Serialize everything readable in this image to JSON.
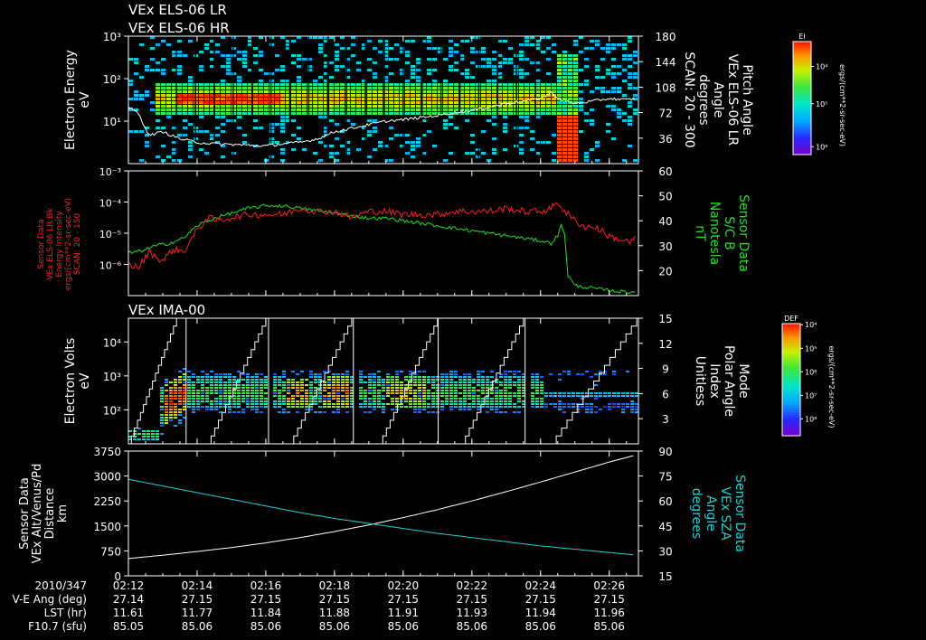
{
  "titles": {
    "top_1": "VEx ELS-06 LR",
    "top_2": "VEx ELS-06 HR",
    "ima": "VEx IMA-00"
  },
  "colors": {
    "background": "#000000",
    "axis": "#ffffff",
    "red_trace": "#ff2020",
    "green_trace": "#20e020",
    "cyan_trace": "#20d0d0",
    "white_trace": "#ffffff"
  },
  "colorbars": [
    {
      "title": "EI",
      "unit_label": "ergs/(cm**2-sr-sec-eV)",
      "tick_labels": [
        "10⁴",
        "10⁵",
        "10⁶"
      ],
      "tick_fractions": [
        0.78,
        0.45,
        0.07
      ]
    },
    {
      "title": "DEF",
      "unit_label": "ergs/(cm**2-sr-sec-eV)",
      "tick_labels": [
        "10⁴",
        "10⁵",
        "10⁶",
        "10⁷",
        "10⁸"
      ],
      "tick_fractions": [
        0.99,
        0.78,
        0.57,
        0.36,
        0.15
      ]
    }
  ],
  "panels": {
    "els": {
      "left_label": [
        "Electron Energy",
        "eV"
      ],
      "right_label": [
        "Pitch Angle",
        "VEx ELS-06 LR",
        "Angle",
        "degrees",
        "SCAN: 20 - 300"
      ],
      "left_ticks": [
        "10³",
        "10²",
        "10¹"
      ],
      "left_tick_values": [
        1000,
        100,
        10
      ],
      "right_ticks": [
        "180",
        "144",
        "108",
        "72",
        "36"
      ],
      "right_tick_values": [
        180,
        144,
        108,
        72,
        36
      ]
    },
    "sensor": {
      "left_label": [
        "Sensor Data",
        "VEx ELS-06 LR Bk",
        "Energy Intensity",
        "ergs/(cm**2-sr-sec-eV)",
        "SCAN: 20 - 150"
      ],
      "right_label": [
        "Sensor Data",
        "S/C B",
        "Nanotesla",
        "nT"
      ],
      "left_ticks": [
        "10⁻³",
        "10⁻⁴",
        "10⁻⁵",
        "10⁻⁶"
      ],
      "left_tick_values": [
        -3,
        -4,
        -5,
        -6
      ],
      "right_ticks": [
        "60",
        "50",
        "40",
        "30",
        "20"
      ],
      "right_tick_values": [
        60,
        50,
        40,
        30,
        20
      ]
    },
    "ima": {
      "left_label": [
        "Electron Volts",
        "eV"
      ],
      "right_label": [
        "Mode",
        "Polar Angle",
        "Index",
        "Unitless"
      ],
      "left_ticks": [
        "10⁴",
        "10³",
        "10²"
      ],
      "left_tick_values": [
        10000,
        1000,
        100
      ],
      "right_ticks": [
        "15",
        "12",
        "9",
        "6",
        "3"
      ],
      "right_tick_values": [
        15,
        12,
        9,
        6,
        3
      ]
    },
    "distance": {
      "left_label": [
        "Sensor Data",
        "VEx Alt/Venus/Pd",
        "Distance",
        "km"
      ],
      "right_label": [
        "Sensor Data",
        "VEx SZA",
        "Angle",
        "degrees"
      ],
      "left_ticks": [
        "3750",
        "3000",
        "2250",
        "1500",
        "750",
        "0"
      ],
      "left_tick_values": [
        3750,
        3000,
        2250,
        1500,
        750,
        0
      ],
      "right_ticks": [
        "90",
        "75",
        "60",
        "45",
        "30",
        "15"
      ],
      "right_tick_values": [
        90,
        75,
        60,
        45,
        30,
        15
      ]
    }
  },
  "time_axis": {
    "date": "2010/347",
    "row_labels": [
      "V-E Ang (deg)",
      "LST (hr)",
      "F10.7 (sfu)"
    ],
    "ticks": [
      "02:12",
      "02:14",
      "02:16",
      "02:18",
      "02:20",
      "02:22",
      "02:24",
      "02:26"
    ],
    "tick_minutes": [
      12,
      14,
      16,
      18,
      20,
      22,
      24,
      26
    ],
    "ve_ang": [
      "27.14",
      "27.15",
      "27.15",
      "27.15",
      "27.15",
      "27.15",
      "27.15",
      "27.15"
    ],
    "lst": [
      "11.61",
      "11.77",
      "11.84",
      "11.88",
      "11.91",
      "11.93",
      "11.94",
      "11.96"
    ],
    "f107": [
      "85.05",
      "85.06",
      "85.06",
      "85.06",
      "85.06",
      "85.06",
      "85.06",
      "85.06"
    ]
  },
  "chart_data": [
    {
      "type": "heatmap",
      "panel": "els",
      "ylabel": "Electron Energy eV",
      "ylim": [
        1,
        1000
      ],
      "y_scale": "log",
      "y2label": "Pitch Angle VEx ELS-06 LR Angle degrees SCAN: 20 - 300",
      "y2lim": [
        0,
        180
      ],
      "overlay_series": {
        "name": "Pitch Angle",
        "x_minutes": [
          12.0,
          12.3,
          12.6,
          13.0,
          13.5,
          14.0,
          14.5,
          15.0,
          15.5,
          16.0,
          16.5,
          17.0,
          17.5,
          18.0,
          18.5,
          19.0,
          19.5,
          20.0,
          20.5,
          21.0,
          21.5,
          22.0,
          22.5,
          23.0,
          23.5,
          24.0,
          24.3,
          24.6,
          25.0,
          25.5,
          26.0,
          26.5,
          26.8
        ],
        "values": [
          80,
          70,
          40,
          45,
          35,
          30,
          28,
          27,
          26,
          25,
          28,
          30,
          35,
          45,
          50,
          55,
          60,
          62,
          65,
          68,
          72,
          75,
          80,
          85,
          88,
          92,
          100,
          90,
          85,
          88,
          92,
          90,
          92
        ]
      }
    },
    {
      "type": "line",
      "panel": "sensor",
      "ylabel": "Sensor Data VEx ELS-06 LR Bk Energy Intensity ergs/(cm**2-sr-sec-eV) SCAN: 20 - 150",
      "y_scale": "log",
      "ylim_log10": [
        -7,
        -3
      ],
      "y2label": "Sensor Data S/C B Nanotesla nT",
      "y2lim": [
        10,
        60
      ],
      "series": [
        {
          "name": "Sensor Data VEx ELS-06 LR Bk",
          "axis": "left",
          "x_minutes": [
            12.0,
            12.3,
            12.6,
            13.0,
            13.3,
            13.6,
            14.0,
            14.3,
            14.6,
            15.0,
            15.5,
            16.0,
            16.5,
            17.0,
            17.5,
            18.0,
            18.5,
            19.0,
            19.5,
            20.0,
            20.5,
            21.0,
            21.5,
            22.0,
            22.5,
            23.0,
            23.5,
            24.0,
            24.3,
            24.5,
            24.7,
            25.0,
            25.3,
            25.6,
            26.0,
            26.3,
            26.6,
            26.8
          ],
          "values_log10": [
            -6.0,
            -6.1,
            -5.6,
            -5.9,
            -5.5,
            -5.6,
            -4.9,
            -4.5,
            -4.6,
            -4.5,
            -4.4,
            -4.4,
            -4.4,
            -4.2,
            -4.3,
            -4.3,
            -4.5,
            -4.3,
            -4.3,
            -4.4,
            -4.4,
            -4.4,
            -4.3,
            -4.3,
            -4.3,
            -4.2,
            -4.3,
            -4.3,
            -4.2,
            -4.0,
            -4.3,
            -4.6,
            -4.8,
            -4.8,
            -5.1,
            -5.2,
            -5.3,
            -5.1
          ]
        },
        {
          "name": "S/C B",
          "axis": "right",
          "x_minutes": [
            12.0,
            12.4,
            12.8,
            13.2,
            13.6,
            14.0,
            14.5,
            15.0,
            15.5,
            16.0,
            16.5,
            17.0,
            17.5,
            18.0,
            18.5,
            19.0,
            19.5,
            20.0,
            20.5,
            21.0,
            21.5,
            22.0,
            22.5,
            23.0,
            23.5,
            24.0,
            24.3,
            24.5,
            24.6,
            24.7,
            24.8,
            25.0,
            25.5,
            26.0,
            26.5,
            26.8
          ],
          "values": [
            27,
            28,
            30,
            31,
            33,
            38,
            41,
            43,
            45,
            46,
            46,
            45,
            44,
            43,
            42,
            41,
            41,
            40,
            39,
            38,
            37,
            36,
            35,
            34,
            33,
            32,
            31,
            34,
            38,
            35,
            18,
            14,
            13,
            12,
            11.5,
            11.5
          ]
        }
      ]
    },
    {
      "type": "heatmap",
      "panel": "ima",
      "ylabel": "Electron Volts eV",
      "ylim": [
        10,
        50000
      ],
      "y_scale": "log",
      "y2label": "Mode Polar Angle Index Unitless",
      "y2lim": [
        0,
        15
      ],
      "overlay_series": {
        "name": "Polar Angle Index",
        "sweep_minutes": [
          [
            12.0,
            13.4
          ],
          [
            14.3,
            16.0
          ],
          [
            16.7,
            18.5
          ],
          [
            19.3,
            21.0
          ],
          [
            21.7,
            23.5
          ],
          [
            24.3,
            26.8
          ]
        ],
        "values_start": 0,
        "values_end": 15
      }
    },
    {
      "type": "line",
      "panel": "distance",
      "ylabel": "Sensor Data VEx Alt/Venus/Pd Distance km",
      "ylim": [
        0,
        3750
      ],
      "y2label": "Sensor Data VEx SZA Angle degrees",
      "y2lim": [
        15,
        90
      ],
      "series": [
        {
          "name": "VEx Alt/Venus/Pd",
          "axis": "left",
          "x_minutes": [
            12.0,
            13.0,
            14.0,
            15.0,
            16.0,
            17.0,
            18.0,
            19.0,
            20.0,
            21.0,
            22.0,
            23.0,
            24.0,
            25.0,
            26.0,
            26.8
          ],
          "values": [
            520,
            620,
            730,
            850,
            990,
            1150,
            1330,
            1530,
            1750,
            1990,
            2250,
            2530,
            2820,
            3120,
            3420,
            3640
          ]
        },
        {
          "name": "VEx SZA",
          "axis": "right",
          "x_minutes": [
            12.0,
            13.0,
            14.0,
            15.0,
            16.0,
            17.0,
            18.0,
            19.0,
            20.0,
            21.0,
            22.0,
            23.0,
            24.0,
            25.0,
            26.0,
            26.8
          ],
          "values": [
            73,
            69,
            65,
            61,
            57,
            53,
            49.5,
            46.5,
            43.5,
            40.5,
            38,
            35.5,
            33,
            31,
            29,
            27.5
          ]
        }
      ]
    }
  ]
}
